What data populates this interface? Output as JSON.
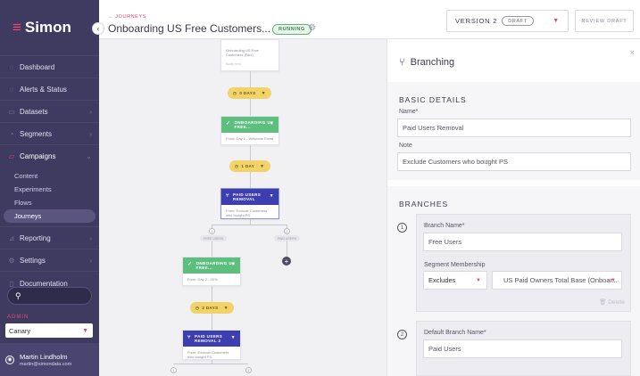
{
  "sidebar": {
    "logo": "Simon",
    "collapse_icon": "‹",
    "items": [
      {
        "label": "Dashboard"
      },
      {
        "label": "Alerts & Status"
      },
      {
        "label": "Datasets"
      },
      {
        "label": "Segments"
      },
      {
        "label": "Campaigns"
      },
      {
        "label": "Reporting"
      },
      {
        "label": "Settings"
      },
      {
        "label": "Documentation"
      }
    ],
    "campaign_sub": [
      "Content",
      "Experiments",
      "Flows",
      "Journeys"
    ],
    "search_icon": "search-icon",
    "admin_label": "ADMIN",
    "org_value": "Canary",
    "user_name": "Martin Lindholm",
    "user_email": "martin@simondata.com",
    "accent": "#e8486a",
    "bg": "#3f3a60"
  },
  "header": {
    "breadcrumb": "← JOURNEYS",
    "title": "Onboarding US Free Customers...",
    "status": "RUNNING",
    "version_label": "VERSION 2",
    "version_state": "DRAFT",
    "review_label": "REVIEW DRAFT"
  },
  "canvas": {
    "top_card_title": "Onboarding US Free Customers (Flex)",
    "top_card_sub": "Body text",
    "delay1": "0 DAYS",
    "email1_title": "ONBOARDING US FREE...",
    "email1_body": "From: Day 1 - Welcome Email",
    "delay2": "1 DAY",
    "branch_title": "PAID USERS REMOVAL",
    "branch_body": "From: Exclude Customers who bought PS",
    "branch1_num": "1",
    "branch1_label": "FREE USERS",
    "branch2_num": "2",
    "branch2_label": "PAID USERS",
    "add_icon": "+",
    "email2_title": "ONBOARDING US FREE...",
    "email2_body": "From: Day 2 - 20%",
    "delay3": "2 DAYS",
    "branch2_title": "PAID USERS REMOVAL 2",
    "branch2_body": "From: Exclude Customers who bought PS",
    "bottom_num1": "1",
    "bottom_num2": "2"
  },
  "panel": {
    "title": "Branching",
    "close_icon": "×",
    "basic_details": "BASIC DETAILS",
    "name_label": "Name*",
    "name_value": "Paid Users Removal",
    "note_label": "Note",
    "note_value": "Exclude Customers who bought PS",
    "branches_title": "BRANCHES",
    "branch1": {
      "num": "1",
      "name_label": "Branch Name*",
      "name_value": "Free Users",
      "segment_label": "Segment Membership",
      "mode": "Excludes",
      "segment": "US Paid Owners Total Base (Onboar...",
      "delete_label": "Delete"
    },
    "branch2": {
      "num": "2",
      "name_label": "Default Branch Name*",
      "name_value": "Paid Users"
    }
  }
}
